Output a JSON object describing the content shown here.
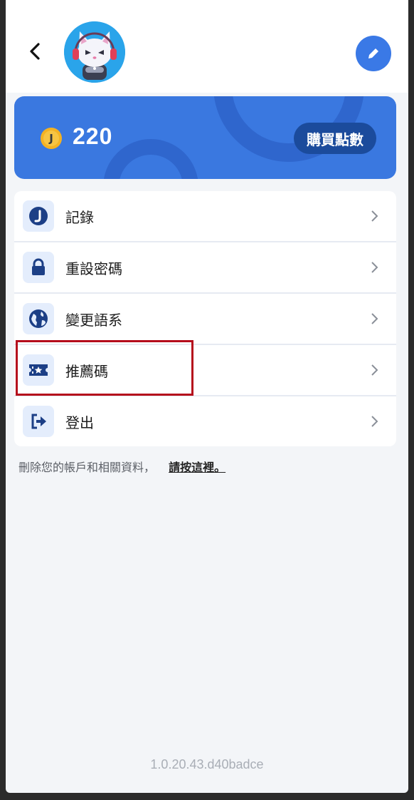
{
  "header": {
    "back_icon": "chevron-left-icon",
    "edit_icon": "pencil-icon",
    "avatar": "cat-gamer-avatar"
  },
  "points": {
    "coin_symbol": "J",
    "value": "220",
    "buy_label": "購買點數"
  },
  "menu": {
    "items": [
      {
        "label": "記錄",
        "icon": "coin-j-icon"
      },
      {
        "label": "重設密碼",
        "icon": "lock-icon"
      },
      {
        "label": "變更語系",
        "icon": "globe-icon"
      },
      {
        "label": "推薦碼",
        "icon": "ticket-star-icon"
      },
      {
        "label": "登出",
        "icon": "logout-icon"
      }
    ]
  },
  "delete_account": {
    "text": "刪除您的帳戶和相關資料，",
    "link": "請按這裡。"
  },
  "version": "1.0.20.43.d40badce",
  "colors": {
    "primary": "#3a78e0",
    "dark_primary": "#1b4b9c",
    "highlight": "#b50d1c"
  }
}
